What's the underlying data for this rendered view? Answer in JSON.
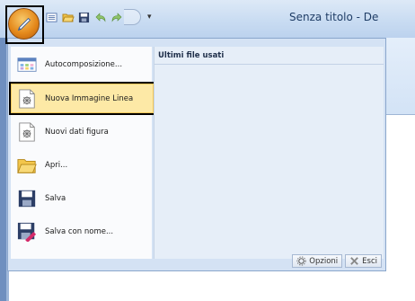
{
  "window": {
    "title": "Senza titolo - De"
  },
  "qat": {
    "items": [
      "list-icon",
      "folder-open-icon",
      "save-icon",
      "undo-icon",
      "redo-icon"
    ],
    "dropdown_glyph": "▾"
  },
  "app_menu": {
    "items": [
      {
        "label": "Autocomposizione...",
        "icon": "wizard-icon"
      },
      {
        "label": "Nuova Immagine Linea",
        "icon": "new-line-image-icon",
        "highlighted": true
      },
      {
        "label": "Nuovi dati figura",
        "icon": "new-figure-data-icon"
      },
      {
        "label": "Apri...",
        "icon": "folder-open-icon"
      },
      {
        "label": "Salva",
        "icon": "save-icon"
      },
      {
        "label": "Salva con nome...",
        "icon": "save-as-icon"
      }
    ],
    "recent_title": "Ultimi file usati",
    "footer": {
      "options_label": "Opzioni",
      "exit_label": "Esci"
    }
  },
  "colors": {
    "titlebar": "#c9dcf2",
    "menu_bg": "#d4e2f4",
    "highlight": "#fde9a6",
    "app_button": "#e58a1c"
  }
}
